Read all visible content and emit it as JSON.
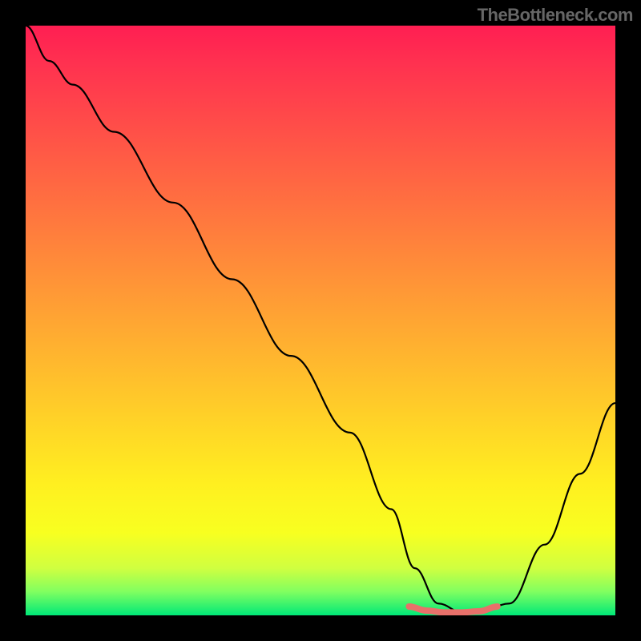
{
  "watermark": "TheBottleneck.com",
  "chart_data": {
    "type": "line",
    "title": "",
    "xlabel": "",
    "ylabel": "",
    "xlim": [
      0,
      100
    ],
    "ylim": [
      0,
      100
    ],
    "background": "vertical-gradient-red-orange-yellow-green",
    "series": [
      {
        "name": "bottleneck-curve",
        "color": "#000000",
        "x": [
          0,
          4,
          8,
          15,
          25,
          35,
          45,
          55,
          62,
          66,
          70,
          74,
          77,
          82,
          88,
          94,
          100
        ],
        "y": [
          100,
          94,
          90,
          82,
          70,
          57,
          44,
          31,
          18,
          8,
          2,
          0.5,
          0.5,
          2,
          12,
          24,
          36
        ]
      },
      {
        "name": "highlight-marker",
        "color": "#e8706a",
        "x": [
          65,
          68,
          71,
          74,
          77,
          80
        ],
        "y": [
          1.5,
          0.8,
          0.5,
          0.5,
          0.7,
          1.5
        ]
      }
    ],
    "optimal_x_range": [
      65,
      80
    ],
    "gradient_stops": [
      {
        "pos": 0,
        "color": "#ff1e52"
      },
      {
        "pos": 18,
        "color": "#ff5048"
      },
      {
        "pos": 42,
        "color": "#ff9038"
      },
      {
        "pos": 66,
        "color": "#ffd028"
      },
      {
        "pos": 86,
        "color": "#f8ff20"
      },
      {
        "pos": 100,
        "color": "#00e878"
      }
    ]
  }
}
